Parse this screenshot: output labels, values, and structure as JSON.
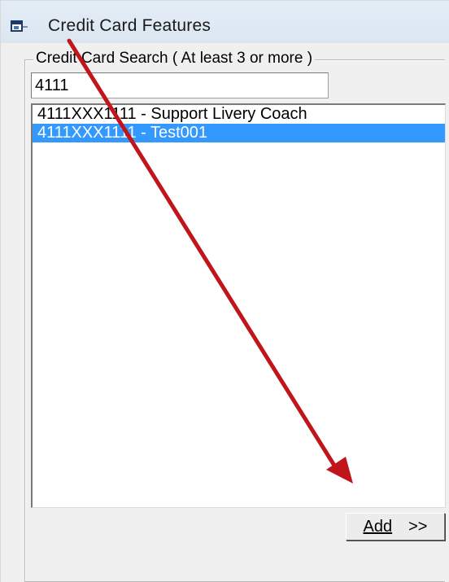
{
  "window": {
    "title": "Credit Card Features",
    "icon": "window-app-icon"
  },
  "search_group": {
    "legend": "Credit Card Search ( At least 3 or more )",
    "input_value": "4111"
  },
  "results": {
    "items": [
      {
        "label": "4111XXX1111 - Support Livery Coach",
        "selected": false
      },
      {
        "label": "4111XXX1111 - Test001",
        "selected": true
      }
    ]
  },
  "actions": {
    "add_label": "Add",
    "add_chevrons": ">>"
  },
  "annotation": {
    "arrow_color": "#c0161b"
  },
  "colors": {
    "selection": "#3399ff",
    "titlebar": "#dbe6f1"
  }
}
